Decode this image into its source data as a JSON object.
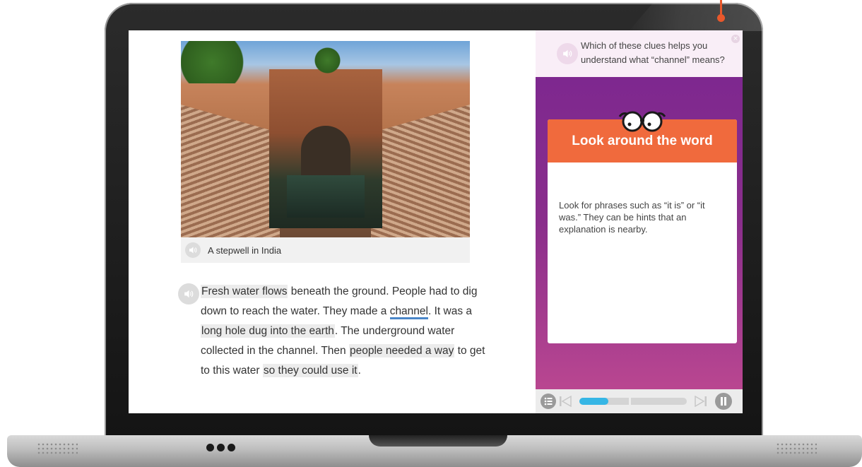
{
  "reading": {
    "image_caption": "A stepwell in India",
    "passage": {
      "s1_hl": "Fresh water flows",
      "s1_rest": " beneath the ground. People had to dig down to reach the water. They made a ",
      "vocab_word": "channel",
      "s2_a": ". It was a ",
      "s2_hl": "long hole dug into the earth",
      "s2_b": ". The underground water collected in the channel. Then ",
      "s3_hl": "people needed a way",
      "s3_b": " to get to this water ",
      "s4_hl": "so they could use it",
      "s4_end": "."
    }
  },
  "panel": {
    "question": "Which of these clues helps you understand what “channel” means?",
    "tip_title": "Look around the word",
    "tip_body": "Look for phrases such as “it is” or “it was.” They can be hints that an explanation is nearby.",
    "progress": 0.27,
    "colors": {
      "panel_purple": "#7a2690",
      "tip_orange": "#f06a3d",
      "progress_blue": "#36b6e5",
      "vocab_underline": "#4a86c8"
    }
  },
  "icons": {
    "audio": "speaker-icon",
    "menu": "list-icon",
    "prev": "skip-back-icon",
    "next": "skip-forward-icon",
    "pause": "pause-icon",
    "mascot": "glasses-icon"
  }
}
